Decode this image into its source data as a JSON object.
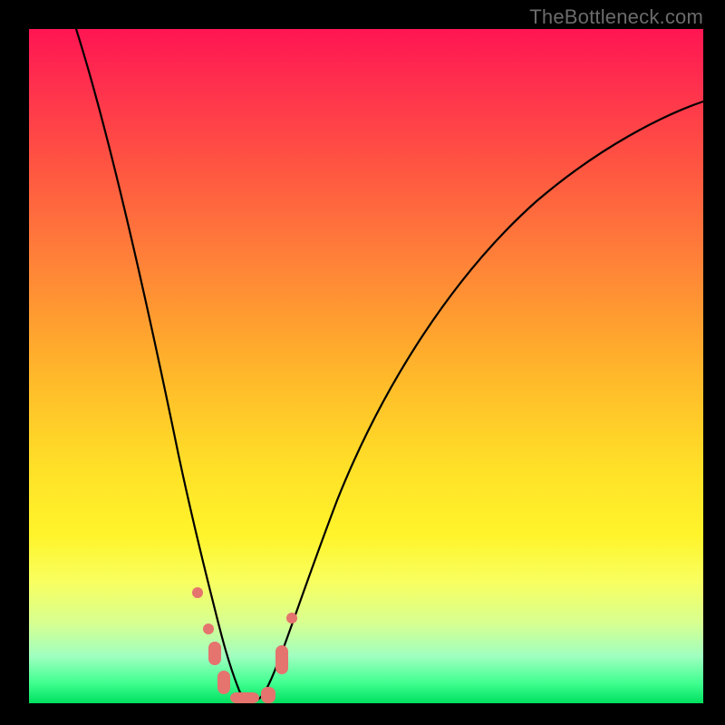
{
  "watermark": "TheBottleneck.com",
  "chart_data": {
    "type": "line",
    "title": "",
    "xlabel": "",
    "ylabel": "",
    "xlim": [
      0,
      100
    ],
    "ylim": [
      0,
      100
    ],
    "x": [
      7,
      10,
      13,
      16,
      19,
      22,
      24,
      25.5,
      27,
      28,
      29,
      30,
      31,
      32,
      33,
      34,
      36,
      40,
      46,
      54,
      62,
      70,
      78,
      86,
      94,
      100
    ],
    "values": [
      100,
      88,
      76,
      64,
      53,
      42,
      32,
      24,
      18,
      12,
      7,
      4,
      2,
      1.5,
      2,
      4,
      9,
      22,
      38,
      54,
      65,
      73,
      79,
      83,
      86,
      88
    ],
    "markers": {
      "x": [
        24.5,
        26.5,
        27.2,
        28.5,
        30.5,
        32.5,
        35.0,
        36.5
      ],
      "y": [
        20,
        12,
        9,
        5,
        2,
        2,
        6,
        12
      ]
    },
    "gradient_colors": {
      "top": "#ff1552",
      "mid_upper": "#ff7a3a",
      "mid": "#ffe028",
      "mid_lower": "#d8ff90",
      "bottom": "#00e060"
    }
  }
}
